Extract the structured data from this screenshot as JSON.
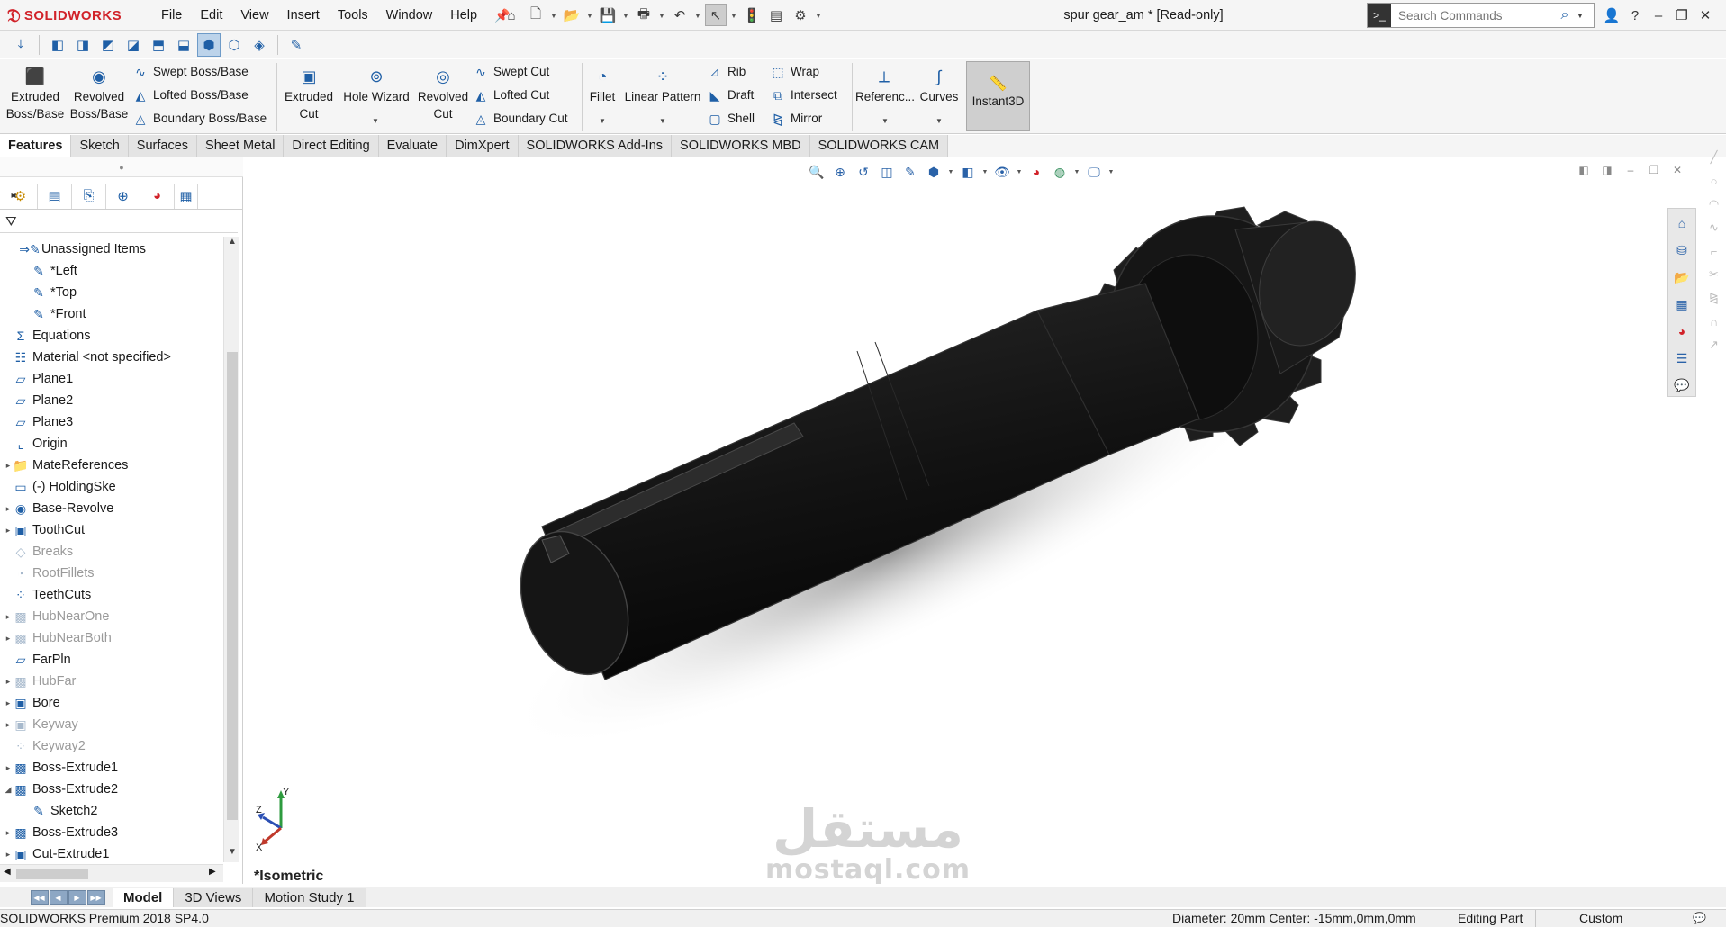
{
  "app": {
    "brand": "SOLIDWORKS",
    "document_title": "spur gear_am * [Read-only]",
    "menu": [
      "File",
      "Edit",
      "View",
      "Insert",
      "Tools",
      "Window",
      "Help"
    ],
    "search_placeholder": "Search Commands"
  },
  "command_manager": {
    "extruded_boss": "Extruded\nBoss/Base",
    "revolved_boss": "Revolved\nBoss/Base",
    "swept_boss": "Swept Boss/Base",
    "lofted_boss": "Lofted Boss/Base",
    "boundary_boss": "Boundary Boss/Base",
    "extruded_cut": "Extruded\nCut",
    "hole_wizard": "Hole Wizard",
    "revolved_cut": "Revolved\nCut",
    "swept_cut": "Swept Cut",
    "lofted_cut": "Lofted Cut",
    "boundary_cut": "Boundary Cut",
    "fillet": "Fillet",
    "linear_pattern": "Linear Pattern",
    "rib": "Rib",
    "draft": "Draft",
    "shell": "Shell",
    "wrap": "Wrap",
    "intersect": "Intersect",
    "mirror": "Mirror",
    "reference": "Referenc...",
    "curves": "Curves",
    "instant3d": "Instant3D"
  },
  "tabs": [
    "Features",
    "Sketch",
    "Surfaces",
    "Sheet Metal",
    "Direct Editing",
    "Evaluate",
    "DimXpert",
    "SOLIDWORKS Add-Ins",
    "SOLIDWORKS MBD",
    "SOLIDWORKS CAM"
  ],
  "tree": [
    {
      "label": "Unassigned Items",
      "icon": "sketch-arrow-icon",
      "indent": 1,
      "dim": false,
      "expander": false
    },
    {
      "label": "*Left",
      "icon": "sketch-icon",
      "indent": 2,
      "dim": false,
      "expander": false
    },
    {
      "label": "*Top",
      "icon": "sketch-icon",
      "indent": 2,
      "dim": false,
      "expander": false
    },
    {
      "label": "*Front",
      "icon": "sketch-icon",
      "indent": 2,
      "dim": false,
      "expander": false
    },
    {
      "label": "Equations",
      "icon": "equations-icon",
      "indent": 0,
      "dim": false,
      "expander": false
    },
    {
      "label": "Material <not specified>",
      "icon": "material-icon",
      "indent": 0,
      "dim": false,
      "expander": false
    },
    {
      "label": "Plane1",
      "icon": "plane-icon",
      "indent": 0,
      "dim": false,
      "expander": false
    },
    {
      "label": "Plane2",
      "icon": "plane-icon",
      "indent": 0,
      "dim": false,
      "expander": false
    },
    {
      "label": "Plane3",
      "icon": "plane-icon",
      "indent": 0,
      "dim": false,
      "expander": false
    },
    {
      "label": "Origin",
      "icon": "origin-icon",
      "indent": 0,
      "dim": false,
      "expander": false
    },
    {
      "label": "MateReferences",
      "icon": "folder-icon",
      "indent": 0,
      "dim": false,
      "expander": true
    },
    {
      "label": "(-) HoldingSke",
      "icon": "sketch-box-icon",
      "indent": 0,
      "dim": false,
      "expander": false
    },
    {
      "label": "Base-Revolve",
      "icon": "revolve-icon",
      "indent": 0,
      "dim": false,
      "expander": true
    },
    {
      "label": "ToothCut",
      "icon": "cut-icon",
      "indent": 0,
      "dim": false,
      "expander": true
    },
    {
      "label": "Breaks",
      "icon": "feature-icon",
      "indent": 0,
      "dim": true,
      "expander": false
    },
    {
      "label": "RootFillets",
      "icon": "fillet-icon",
      "indent": 0,
      "dim": true,
      "expander": false
    },
    {
      "label": "TeethCuts",
      "icon": "pattern-icon",
      "indent": 0,
      "dim": false,
      "expander": false
    },
    {
      "label": "HubNearOne",
      "icon": "extrude-icon",
      "indent": 0,
      "dim": true,
      "expander": true
    },
    {
      "label": "HubNearBoth",
      "icon": "extrude-icon",
      "indent": 0,
      "dim": true,
      "expander": true
    },
    {
      "label": "FarPln",
      "icon": "plane-icon",
      "indent": 0,
      "dim": false,
      "expander": false
    },
    {
      "label": "HubFar",
      "icon": "extrude-icon",
      "indent": 0,
      "dim": true,
      "expander": true
    },
    {
      "label": "Bore",
      "icon": "cut-icon",
      "indent": 0,
      "dim": false,
      "expander": true
    },
    {
      "label": "Keyway",
      "icon": "cut-icon",
      "indent": 0,
      "dim": true,
      "expander": true
    },
    {
      "label": "Keyway2",
      "icon": "pattern-icon",
      "indent": 0,
      "dim": true,
      "expander": false
    },
    {
      "label": "Boss-Extrude1",
      "icon": "extrude-icon",
      "indent": 0,
      "dim": false,
      "expander": true
    },
    {
      "label": "Boss-Extrude2",
      "icon": "extrude-icon",
      "indent": 0,
      "dim": false,
      "expander": true,
      "expanded": true
    },
    {
      "label": "Sketch2",
      "icon": "sketch-icon",
      "indent": 2,
      "dim": false,
      "expander": false
    },
    {
      "label": "Boss-Extrude3",
      "icon": "extrude-icon",
      "indent": 0,
      "dim": false,
      "expander": true
    },
    {
      "label": "Cut-Extrude1",
      "icon": "cut-icon",
      "indent": 0,
      "dim": false,
      "expander": true
    }
  ],
  "graphics": {
    "view_label": "*Isometric",
    "triad": {
      "z": "Z",
      "x": "X",
      "y": "Y"
    },
    "watermark_ar": "مستقل",
    "watermark_lat": "mostaql.com"
  },
  "bottom_tabs": [
    "Model",
    "3D Views",
    "Motion Study 1"
  ],
  "status": {
    "product": "SOLIDWORKS Premium 2018 SP4.0",
    "measure": "Diameter: 20mm  Center: -15mm,0mm,0mm",
    "mode": "Editing Part",
    "units": "Custom"
  },
  "colors": {
    "brand_red": "#d12229",
    "accent_blue": "#1f5fa6",
    "model_body": "#1a1a1a"
  }
}
